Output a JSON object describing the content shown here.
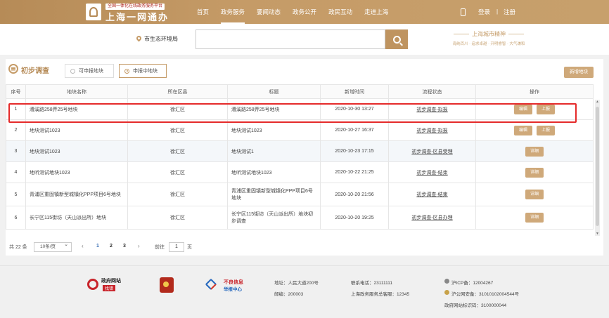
{
  "header": {
    "brand_sub": "全国一体化在线政务服务平台",
    "brand_main": "上海一网通办",
    "nav": [
      "首页",
      "政务服务",
      "要闻动态",
      "政务公开",
      "政民互动",
      "走进上海"
    ],
    "active_nav": "政务服务",
    "login": "登录",
    "separator": "|",
    "register": "注册"
  },
  "search": {
    "location": "市生态环境局",
    "placeholder": "",
    "city_title": "上海城市精神",
    "city_sub": "海纳百川 · 追求卓越 · 开明睿智 · 大气谦和"
  },
  "page": {
    "title": "初步调查",
    "radio_available": "可申报地块",
    "radio_reporting": "申报中地块",
    "new_button": "新增地块"
  },
  "table": {
    "headers": [
      "序号",
      "地块名称",
      "所在区县",
      "标题",
      "新增时间",
      "流程状态",
      "操作"
    ],
    "rows": [
      {
        "no": "1",
        "name": "漕溪路258弄25号地块",
        "district": "徐汇区",
        "title": "漕溪路258弄25号地块",
        "time": "2020-10-30 13:27",
        "status": "初步调查-拟报",
        "actions": [
          "编辑",
          "上报"
        ]
      },
      {
        "no": "2",
        "name": "地块测试1023",
        "district": "徐汇区",
        "title": "地块测试1023",
        "time": "2020-10-27 16:37",
        "status": "初步调查-拟报",
        "actions": [
          "编辑",
          "上报"
        ]
      },
      {
        "no": "3",
        "name": "地块测试1023",
        "district": "徐汇区",
        "title": "地块测试1",
        "time": "2020-10-23 17:15",
        "status": "初步调查-区县受理",
        "actions": [
          "详细"
        ]
      },
      {
        "no": "4",
        "name": "地听测试地块1023",
        "district": "徐汇区",
        "title": "地听测试地块1023",
        "time": "2020-10-22 21:25",
        "status": "初步调查-结束",
        "actions": [
          "详细"
        ]
      },
      {
        "no": "5",
        "name": "青浦区重固镇新型城镇化PPP项目6号地块",
        "district": "徐汇区",
        "title": "青浦区重固镇新型城镇化PPP项目6号地块",
        "time": "2020-10-20 21:56",
        "status": "初步调查-结束",
        "actions": [
          "详细"
        ]
      },
      {
        "no": "6",
        "name": "长宁区115街坊（天山派出所）地块",
        "district": "徐汇区",
        "title": "长宁区115街坊（天山派出所）地块初步调查",
        "time": "2020-10-20 19:25",
        "status": "初步调查-区县办理",
        "actions": [
          "详细"
        ]
      }
    ]
  },
  "pager": {
    "total": "共 22 条",
    "per_page": "10条/页",
    "prev": "‹",
    "pages": [
      "1",
      "2",
      "3"
    ],
    "current": "1",
    "next": "›",
    "goto_label": "前往",
    "goto_value": "1",
    "goto_unit": "页"
  },
  "footer": {
    "badge1_title": "政府网站",
    "badge1_sub": "找错",
    "badge3_title": "不良信息",
    "badge3_sub": "举报中心",
    "address": "地址：人民大道200号",
    "postcode": "邮编：200003",
    "phone": "联系电话：23111111",
    "hotline": "上海政务服务总客服：12345",
    "icp": "沪ICP备：12004267",
    "police": "沪公网安备：31010102004544号",
    "site_id": "政府网站标识码：3100000044"
  },
  "colors": {
    "brand": "#c59b67",
    "highlight": "#e52a2a"
  }
}
